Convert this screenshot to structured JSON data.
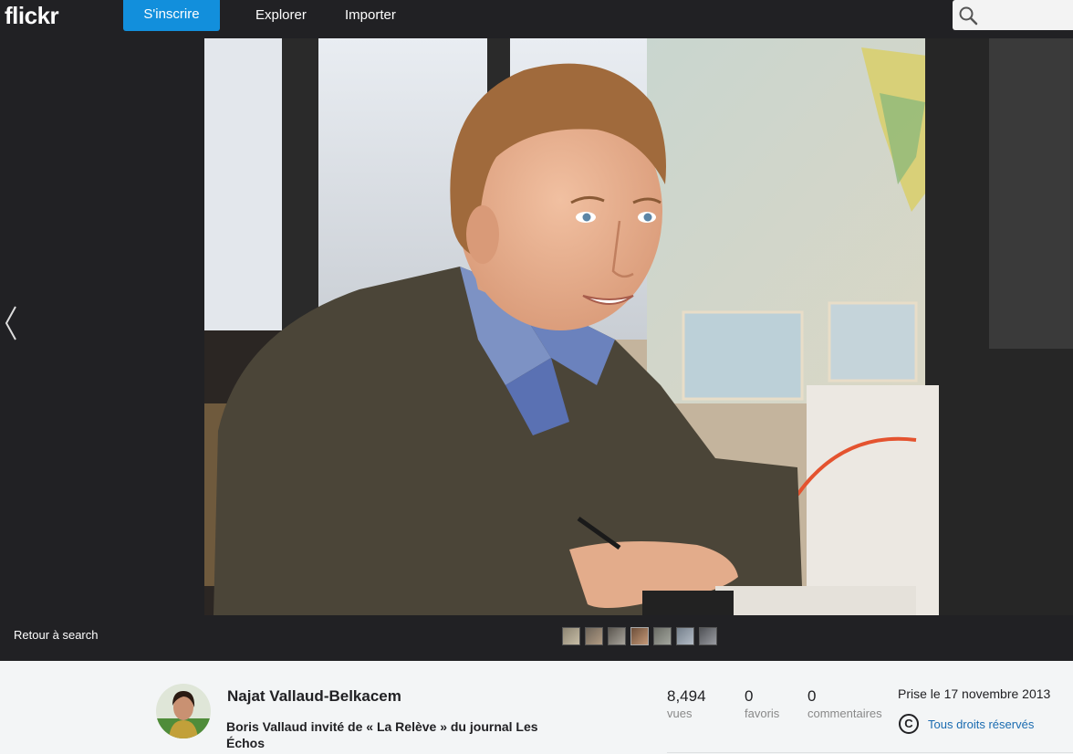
{
  "nav": {
    "logo": "flickr",
    "signup_label": "S'inscrire",
    "explore_label": "Explorer",
    "upload_label": "Importer",
    "search_placeholder": ""
  },
  "stage": {
    "back_label": "Retour à search",
    "thumbnail_count": 7
  },
  "photo": {
    "owner": "Najat Vallaud-Belkacem",
    "title": "Boris Vallaud invité de « La Relève » du journal Les Échos",
    "views": "8,494",
    "views_label": "vues",
    "faves": "0",
    "faves_label": "favoris",
    "comments": "0",
    "comments_label": "commentaires",
    "taken": "Prise le 17 novembre 2013",
    "license_symbol": "C",
    "license_label": "Tous droits réservés"
  },
  "colors": {
    "accent": "#128fdc",
    "dark_bg": "#212124",
    "info_bg": "#f3f5f6",
    "link": "#1a6bb0"
  }
}
